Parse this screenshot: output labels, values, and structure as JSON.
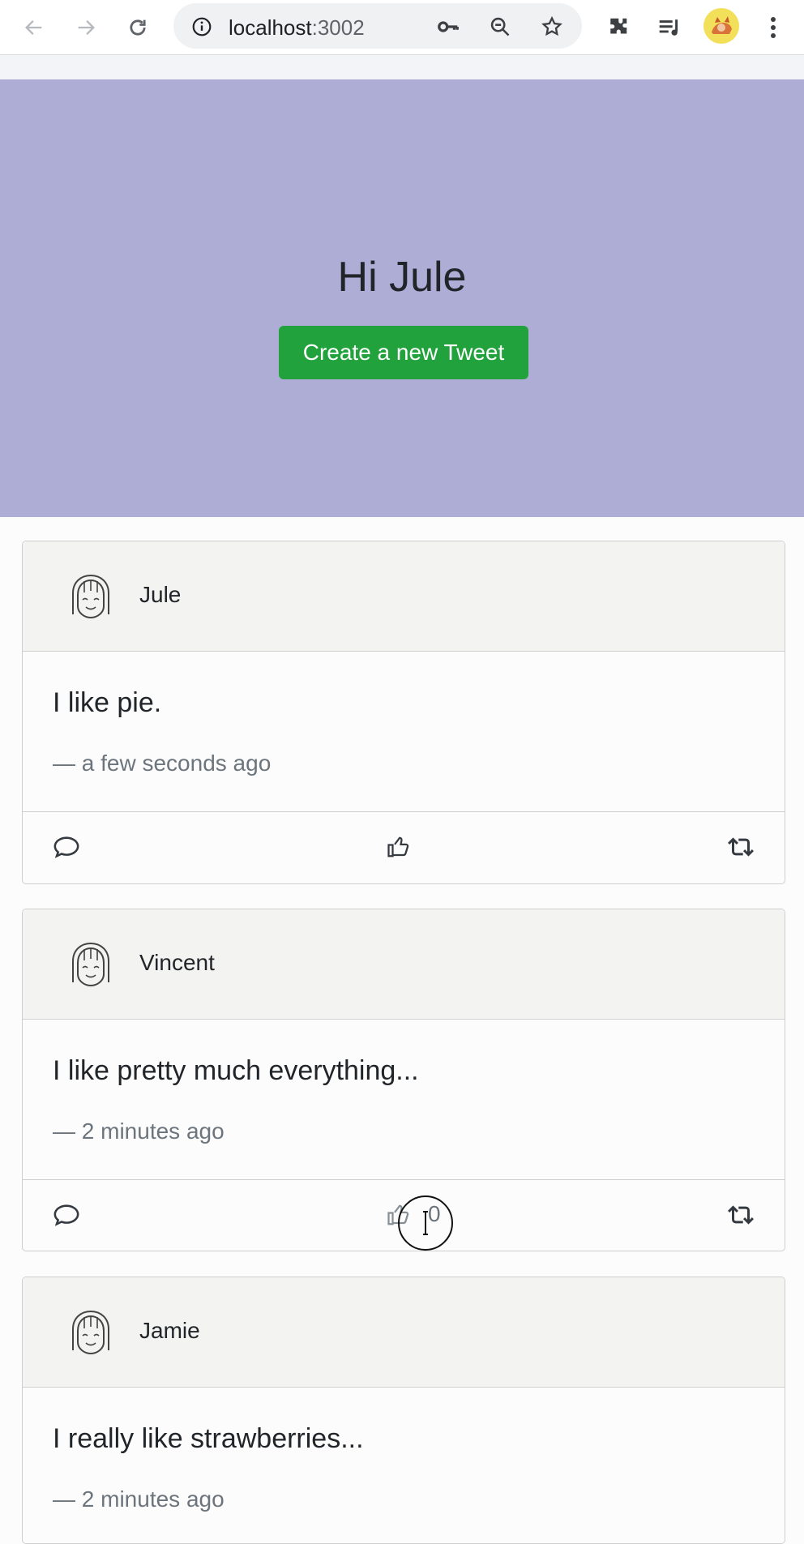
{
  "browser": {
    "url_host": "localhost",
    "url_port": ":3002",
    "icons": [
      "back-icon",
      "forward-icon",
      "reload-icon",
      "info-icon",
      "key-icon",
      "zoom-out-icon",
      "star-icon",
      "extensions-icon",
      "media-queue-icon",
      "profile-avatar",
      "menu-icon"
    ]
  },
  "hero": {
    "title": "Hi Jule",
    "button_label": "Create a new Tweet"
  },
  "tweets": [
    {
      "author": "Jule",
      "text": "I like pie.",
      "time": "— a few seconds ago",
      "likes": ""
    },
    {
      "author": "Vincent",
      "text": "I like pretty much everything...",
      "time": "— 2 minutes ago",
      "likes": "0"
    },
    {
      "author": "Jamie",
      "text": "I really like strawberries...",
      "time": "— 2 minutes ago",
      "likes": ""
    }
  ],
  "colors": {
    "hero_bg": "#adadd6",
    "button_green": "#22a23c",
    "card_header_bg": "#f3f3f1"
  }
}
